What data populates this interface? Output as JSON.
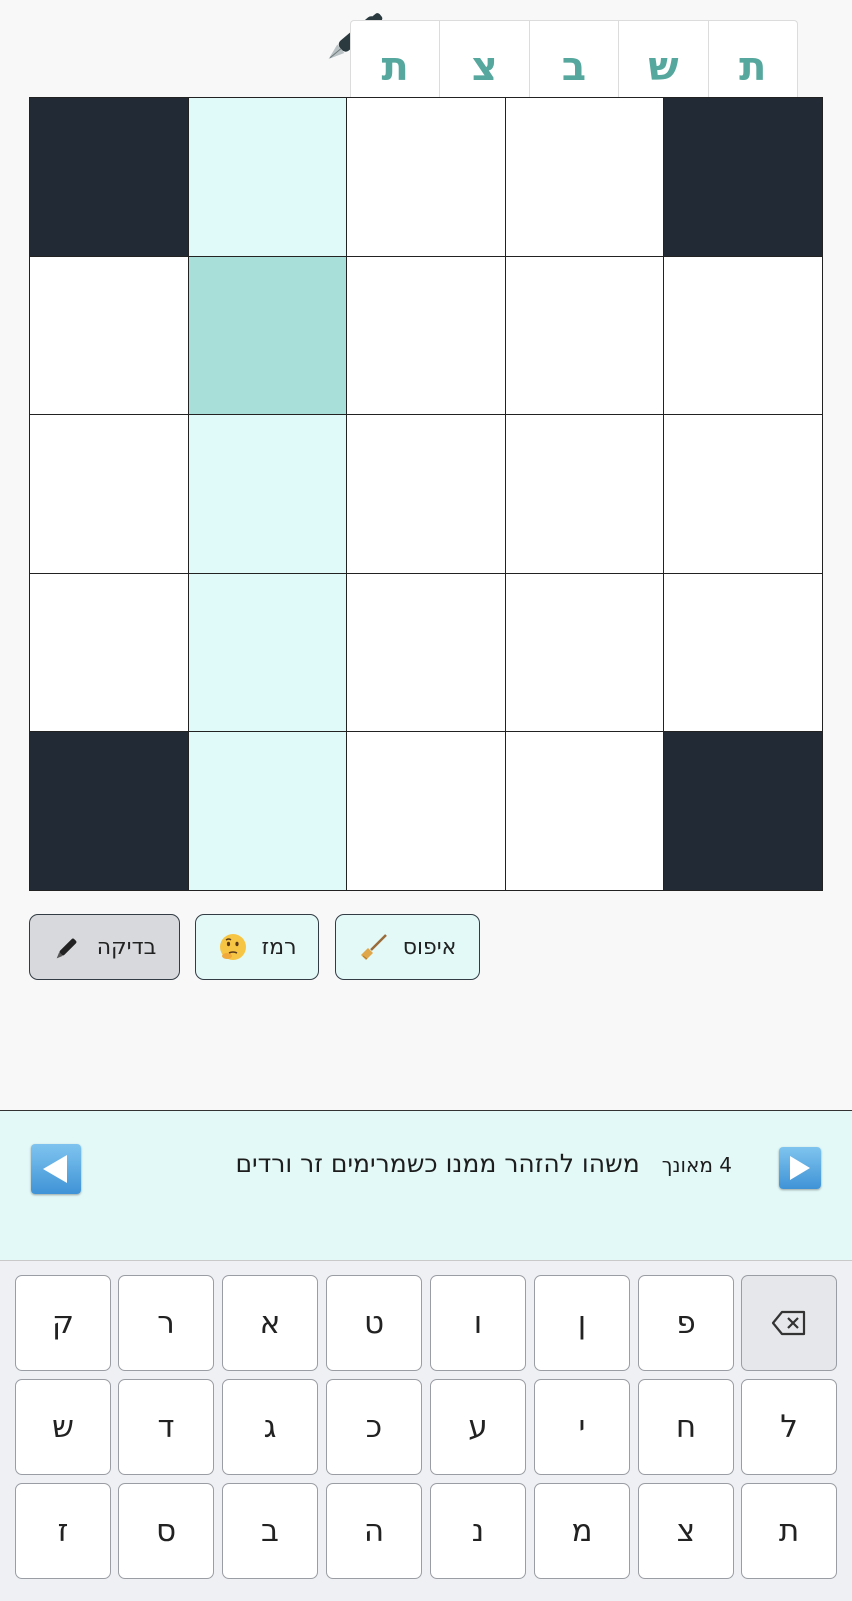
{
  "tabs": [
    "ת",
    "ש",
    "ב",
    "צ",
    "ת"
  ],
  "grid": [
    [
      "black",
      "hl",
      "white",
      "white",
      "black"
    ],
    [
      "white",
      "active",
      "white",
      "white",
      "white"
    ],
    [
      "white",
      "hl",
      "white",
      "white",
      "white"
    ],
    [
      "white",
      "hl",
      "white",
      "white",
      "white"
    ],
    [
      "black",
      "hl",
      "white",
      "white",
      "black"
    ]
  ],
  "buttons": {
    "check": "בדיקה",
    "hint": "רמז",
    "reset": "איפוס"
  },
  "clue": {
    "number": "4 מאונך",
    "text": "משהו להזהר ממנו כשמרימים זר ורדים"
  },
  "keyboard": {
    "row1": [
      "ק",
      "ר",
      "א",
      "ט",
      "ו",
      "ן",
      "פ"
    ],
    "row2": [
      "ש",
      "ד",
      "ג",
      "כ",
      "ע",
      "י",
      "ח",
      "ל"
    ],
    "row3": [
      "ז",
      "ס",
      "ב",
      "ה",
      "נ",
      "מ",
      "צ",
      "ת"
    ]
  },
  "colors": {
    "accent": "#56a79d",
    "highlight": "#e0f9f9",
    "active": "#a9dfd9",
    "block": "#222a36"
  }
}
